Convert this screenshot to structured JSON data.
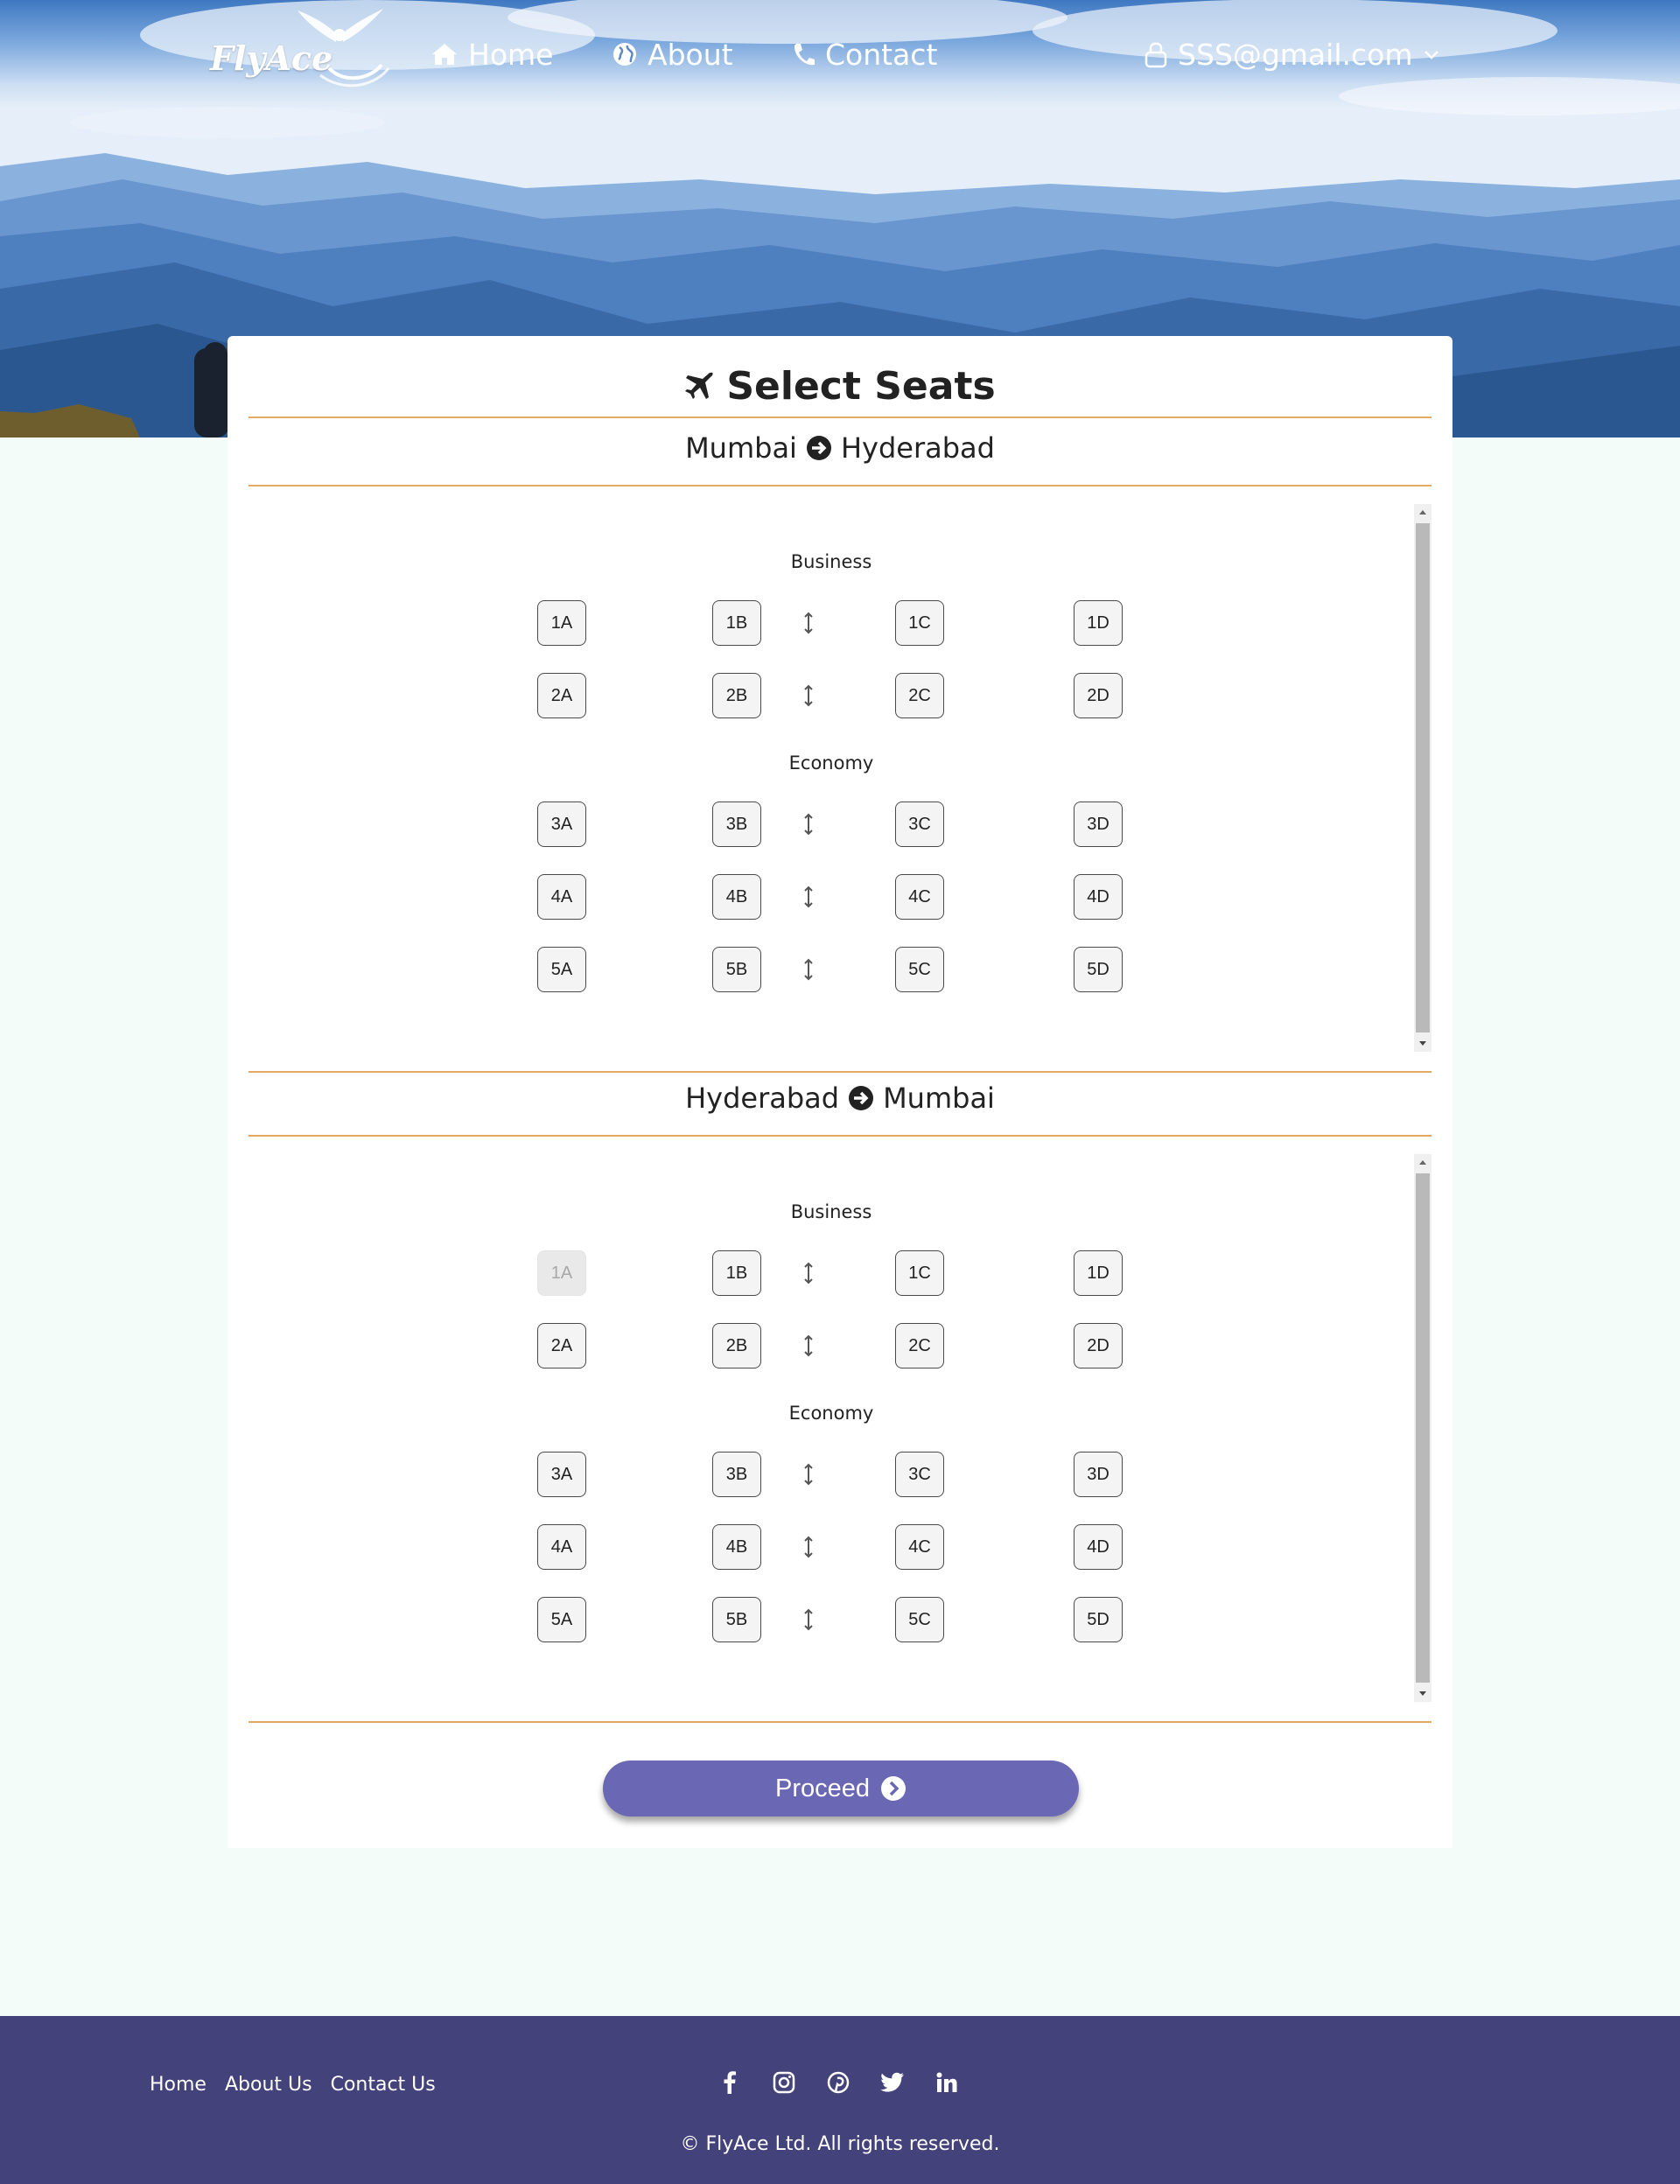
{
  "brand": {
    "name": "FlyAce"
  },
  "nav": {
    "home": "Home",
    "about": "About",
    "contact": "Contact",
    "user": "SSS@gmail.com"
  },
  "page": {
    "title": "Select Seats"
  },
  "flights": [
    {
      "from": "Mumbai",
      "to": "Hyderabad",
      "classes": [
        {
          "name": "Business",
          "rows": [
            [
              "1A",
              "1B",
              "1C",
              "1D"
            ],
            [
              "2A",
              "2B",
              "2C",
              "2D"
            ]
          ]
        },
        {
          "name": "Economy",
          "rows": [
            [
              "3A",
              "3B",
              "3C",
              "3D"
            ],
            [
              "4A",
              "4B",
              "4C",
              "4D"
            ],
            [
              "5A",
              "5B",
              "5C",
              "5D"
            ]
          ]
        }
      ],
      "unavailable": []
    },
    {
      "from": "Hyderabad",
      "to": "Mumbai",
      "classes": [
        {
          "name": "Business",
          "rows": [
            [
              "1A",
              "1B",
              "1C",
              "1D"
            ],
            [
              "2A",
              "2B",
              "2C",
              "2D"
            ]
          ]
        },
        {
          "name": "Economy",
          "rows": [
            [
              "3A",
              "3B",
              "3C",
              "3D"
            ],
            [
              "4A",
              "4B",
              "4C",
              "4D"
            ],
            [
              "5A",
              "5B",
              "5C",
              "5D"
            ]
          ]
        }
      ],
      "unavailable": [
        "1A"
      ]
    }
  ],
  "actions": {
    "proceed": "Proceed"
  },
  "footer": {
    "links": [
      "Home",
      "About Us",
      "Contact Us"
    ],
    "social": [
      "facebook-icon",
      "instagram-icon",
      "pinterest-icon",
      "twitter-icon",
      "linkedin-icon"
    ],
    "copyright": "© FlyAce Ltd. All rights reserved."
  },
  "colors": {
    "accent_line": "#e3a963",
    "proceed_button": "#6a68b4",
    "footer_bg": "#44427a",
    "page_bg": "#f3fcf8"
  }
}
